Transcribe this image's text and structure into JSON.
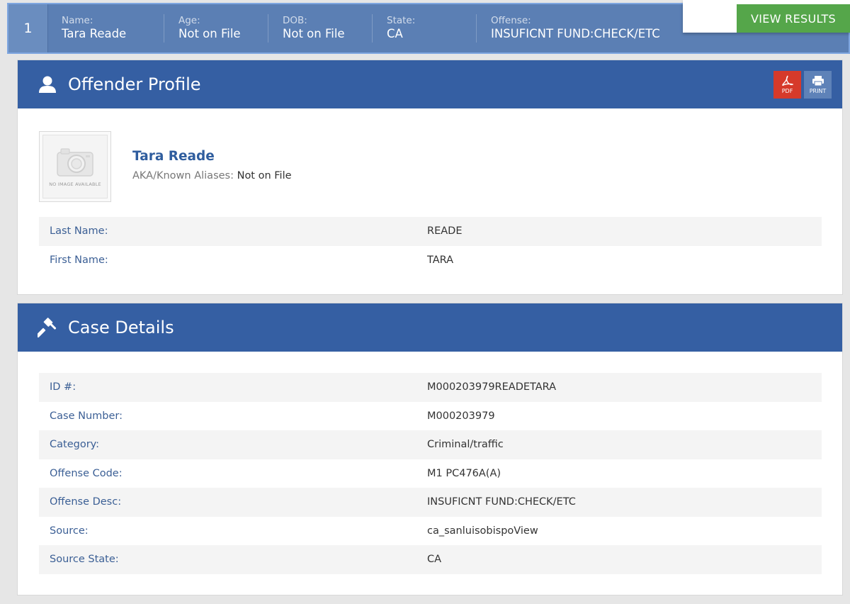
{
  "summary": {
    "index": "1",
    "fields": {
      "name": {
        "label": "Name:",
        "value": "Tara Reade"
      },
      "age": {
        "label": "Age:",
        "value": "Not on File"
      },
      "dob": {
        "label": "DOB:",
        "value": "Not on File"
      },
      "state": {
        "label": "State:",
        "value": "CA"
      },
      "offense": {
        "label": "Offense:",
        "value": "INSUFICNT FUND:CHECK/ETC"
      }
    },
    "view_results_label": "VIEW RESULTS"
  },
  "profile": {
    "title": "Offender Profile",
    "pdf_label": "PDF",
    "print_label": "PRINT",
    "no_image_text": "NO IMAGE AVAILABLE",
    "name": "Tara Reade",
    "aka_label": "AKA/Known Aliases:",
    "aka_value": "Not on File",
    "rows": [
      {
        "label": "Last Name:",
        "value": "READE"
      },
      {
        "label": "First Name:",
        "value": "TARA"
      }
    ]
  },
  "case": {
    "title": "Case Details",
    "rows": [
      {
        "label": "ID #:",
        "value": "M000203979READETARA"
      },
      {
        "label": "Case Number:",
        "value": "M000203979"
      },
      {
        "label": "Category:",
        "value": "Criminal/traffic"
      },
      {
        "label": "Offense Code:",
        "value": "M1 PC476A(A)"
      },
      {
        "label": "Offense Desc:",
        "value": "INSUFICNT FUND:CHECK/ETC"
      },
      {
        "label": "Source:",
        "value": "ca_sanluisobispoView"
      },
      {
        "label": "Source State:",
        "value": "CA"
      }
    ]
  },
  "colors": {
    "header_blue": "#355fa3",
    "summary_blue": "#5b7fb4",
    "green_button": "#55a64a",
    "pdf_red": "#d63a2a",
    "label_blue": "#3b5f95"
  },
  "icons": {
    "profile_header": "user-icon",
    "case_header": "gavel-icon",
    "pdf": "pdf-icon",
    "print": "printer-icon",
    "photo": "camera-icon"
  }
}
